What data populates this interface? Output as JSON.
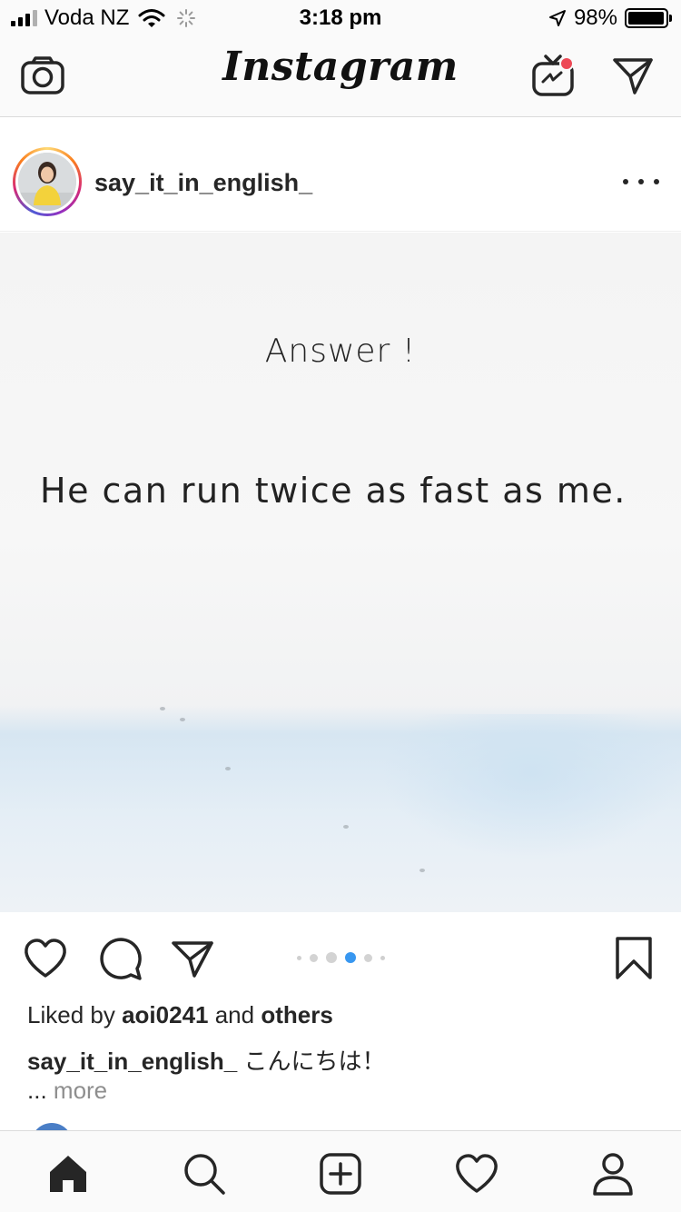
{
  "status_bar": {
    "carrier": "Voda NZ",
    "time": "3:18 pm",
    "battery_percent": "98%",
    "battery_level": 0.98,
    "signal_bars": 3
  },
  "header": {
    "logo_text": "Instagram",
    "icons": [
      "camera-icon",
      "igtv-icon",
      "direct-message-icon"
    ],
    "notification_dot_color": "#ed4956"
  },
  "post": {
    "username": "say_it_in_english_",
    "image": {
      "title_text": "Answer !",
      "sentence": "He can run twice as fast as me."
    },
    "carousel": {
      "total": 5,
      "active_index": 3,
      "active_color": "#3897f0"
    },
    "likes": {
      "prefix": "Liked by",
      "user": "aoi0241",
      "conj": "and",
      "others": "others"
    },
    "caption": {
      "username": "say_it_in_english_",
      "text": "こんにちは！"
    },
    "more": {
      "ellipsis": "...",
      "label": "more"
    }
  },
  "tab_bar": {
    "items": [
      "home-icon",
      "search-icon",
      "new-post-icon",
      "activity-icon",
      "profile-icon"
    ],
    "active": "home-icon"
  }
}
